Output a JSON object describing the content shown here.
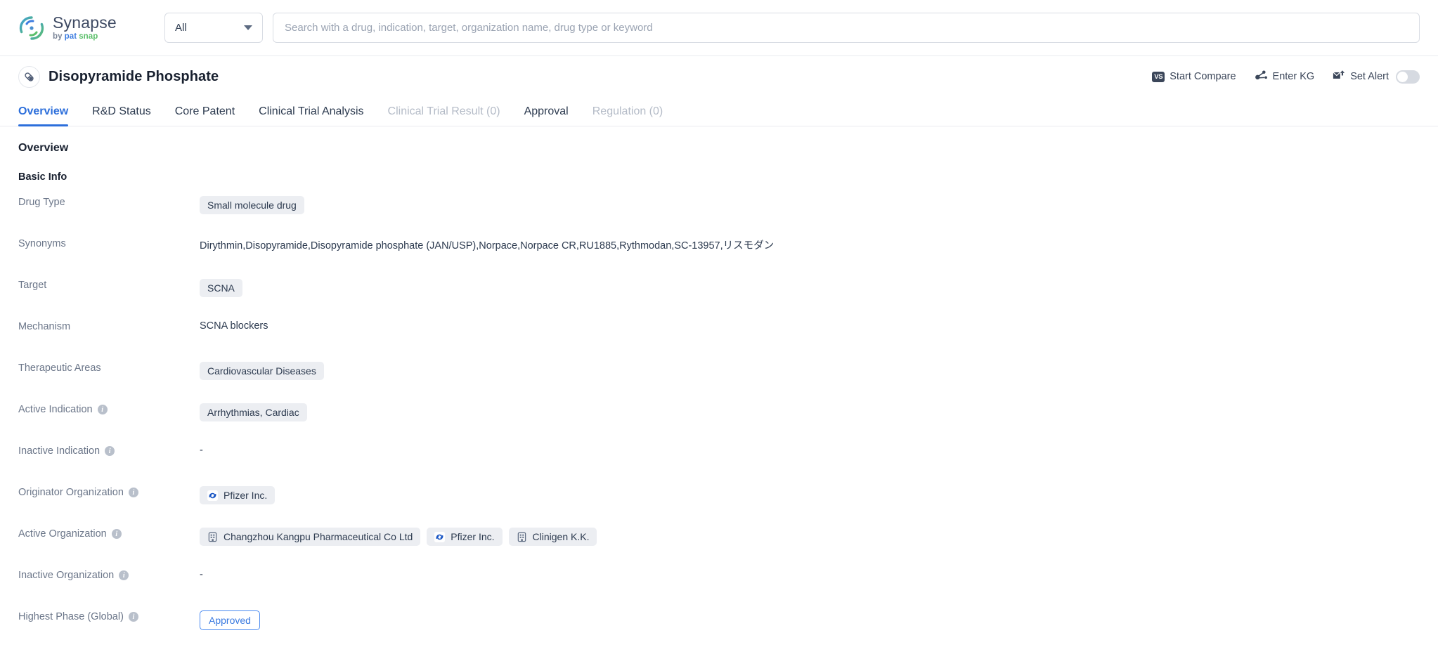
{
  "brand": {
    "name": "Synapse",
    "by": "by",
    "pat": "pat",
    "snap": "snap",
    "logo_blue": "#3e7de0",
    "logo_green": "#5bbf6a"
  },
  "search": {
    "scope_selected": "All",
    "placeholder": "Search with a drug, indication, target, organization name, drug type or keyword",
    "value": ""
  },
  "header": {
    "drug_icon": "capsule-icon",
    "title": "Disopyramide Phosphate",
    "actions": [
      {
        "label": "Start Compare",
        "icon": "vs-badge-icon",
        "badge": "VS"
      },
      {
        "label": "Enter KG",
        "icon": "knowledge-graph-icon"
      },
      {
        "label": "Set Alert",
        "icon": "alert-envelope-icon",
        "toggle": "off"
      }
    ]
  },
  "tabs": [
    {
      "label": "Overview",
      "state": "active"
    },
    {
      "label": "R&D Status",
      "state": "normal"
    },
    {
      "label": "Core Patent",
      "state": "normal"
    },
    {
      "label": "Clinical Trial Analysis",
      "state": "normal"
    },
    {
      "label": "Clinical Trial Result (0)",
      "state": "disabled"
    },
    {
      "label": "Approval",
      "state": "normal"
    },
    {
      "label": "Regulation (0)",
      "state": "disabled"
    }
  ],
  "overview": {
    "section_title": "Overview",
    "subsection_title": "Basic Info",
    "rows": [
      {
        "label": "Drug Type",
        "has_info": false,
        "type": "tags",
        "tags": [
          {
            "text": "Small molecule drug"
          }
        ]
      },
      {
        "label": "Synonyms",
        "has_info": false,
        "type": "text",
        "text": "Dirythmin,Disopyramide,Disopyramide phosphate (JAN/USP),Norpace,Norpace CR,RU1885,Rythmodan,SC-13957,リスモダン"
      },
      {
        "label": "Target",
        "has_info": false,
        "type": "tags",
        "tags": [
          {
            "text": "SCNA"
          }
        ]
      },
      {
        "label": "Mechanism",
        "has_info": false,
        "type": "text",
        "text": "SCNA blockers"
      },
      {
        "label": "Therapeutic Areas",
        "has_info": false,
        "type": "tags",
        "tags": [
          {
            "text": "Cardiovascular Diseases"
          }
        ]
      },
      {
        "label": "Active Indication",
        "has_info": true,
        "type": "tags",
        "tags": [
          {
            "text": "Arrhythmias, Cardiac"
          }
        ]
      },
      {
        "label": "Inactive Indication",
        "has_info": true,
        "type": "empty",
        "text": "-"
      },
      {
        "label": "Originator Organization",
        "has_info": true,
        "type": "tags",
        "tags": [
          {
            "text": "Pfizer Inc.",
            "icon": "pfizer-logo-icon"
          }
        ]
      },
      {
        "label": "Active Organization",
        "has_info": true,
        "type": "tags",
        "tags": [
          {
            "text": "Changzhou Kangpu Pharmaceutical Co Ltd",
            "icon": "company-building-icon"
          },
          {
            "text": "Pfizer Inc.",
            "icon": "pfizer-logo-icon"
          },
          {
            "text": "Clinigen K.K.",
            "icon": "company-building-icon"
          }
        ]
      },
      {
        "label": "Inactive Organization",
        "has_info": true,
        "type": "empty",
        "text": "-"
      },
      {
        "label": "Highest Phase (Global)",
        "has_info": true,
        "type": "badge",
        "badge": "Approved"
      }
    ],
    "info_glyph": "i"
  },
  "colors": {
    "accent_blue": "#2d6fdb",
    "tag_bg": "#eceef2",
    "label_grey": "#6b7689",
    "disabled_tab": "#b4bbc7"
  }
}
